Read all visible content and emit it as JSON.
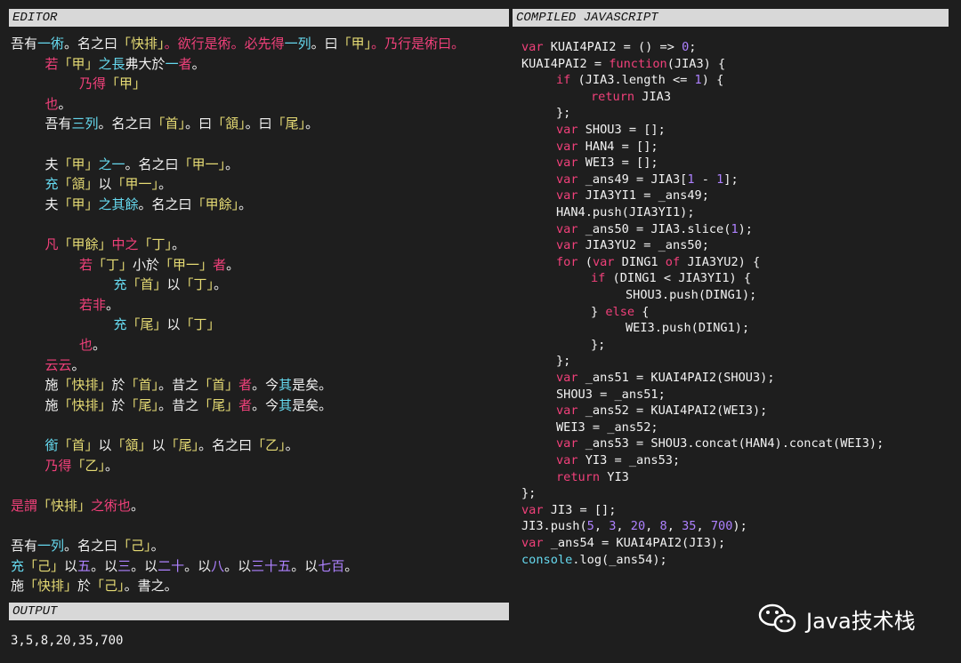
{
  "colors": {
    "white": "#f2f2f2",
    "pink": "#f0407a",
    "green": "#a6e22e",
    "yellow": "#e6db74",
    "cyan": "#66d9ef",
    "purple": "#ae81ff",
    "header_bg": "#d8d8d8"
  },
  "editor": {
    "title": "EDITOR",
    "lines": [
      {
        "indent": 0,
        "segs": [
          [
            "吾有",
            "w"
          ],
          [
            "一術",
            "c"
          ],
          [
            "。名之曰",
            "w"
          ],
          [
            "「快排」",
            "y"
          ],
          [
            "。欲行是術。必先得",
            "p"
          ],
          [
            "一列",
            "c"
          ],
          [
            "。曰",
            "w"
          ],
          [
            "「甲」",
            "y"
          ],
          [
            "。乃行是術曰。",
            "p"
          ]
        ]
      },
      {
        "indent": 1,
        "segs": [
          [
            "若",
            "p"
          ],
          [
            "「甲」",
            "y"
          ],
          [
            "之長",
            "c"
          ],
          [
            "弗大於",
            "w"
          ],
          [
            "一",
            "c"
          ],
          [
            "者",
            "p"
          ],
          [
            "。",
            "w"
          ]
        ]
      },
      {
        "indent": 2,
        "segs": [
          [
            "乃得",
            "p"
          ],
          [
            "「甲」",
            "y"
          ]
        ]
      },
      {
        "indent": 1,
        "segs": [
          [
            "也",
            "p"
          ],
          [
            "。",
            "w"
          ]
        ]
      },
      {
        "indent": 1,
        "segs": [
          [
            "吾有",
            "w"
          ],
          [
            "三列",
            "c"
          ],
          [
            "。名之曰",
            "w"
          ],
          [
            "「首」",
            "y"
          ],
          [
            "。曰",
            "w"
          ],
          [
            "「頷」",
            "y"
          ],
          [
            "。曰",
            "w"
          ],
          [
            "「尾」",
            "y"
          ],
          [
            "。",
            "w"
          ]
        ]
      },
      null,
      {
        "indent": 1,
        "segs": [
          [
            "夫",
            "w"
          ],
          [
            "「甲」",
            "y"
          ],
          [
            "之一",
            "c"
          ],
          [
            "。名之曰",
            "w"
          ],
          [
            "「甲一」",
            "y"
          ],
          [
            "。",
            "w"
          ]
        ]
      },
      {
        "indent": 1,
        "segs": [
          [
            "充",
            "c"
          ],
          [
            "「頷」",
            "y"
          ],
          [
            "以",
            "w"
          ],
          [
            "「甲一」",
            "y"
          ],
          [
            "。",
            "w"
          ]
        ]
      },
      {
        "indent": 1,
        "segs": [
          [
            "夫",
            "w"
          ],
          [
            "「甲」",
            "y"
          ],
          [
            "之其餘",
            "c"
          ],
          [
            "。名之曰",
            "w"
          ],
          [
            "「甲餘」",
            "y"
          ],
          [
            "。",
            "w"
          ]
        ]
      },
      null,
      {
        "indent": 1,
        "segs": [
          [
            "凡",
            "p"
          ],
          [
            "「甲餘」",
            "y"
          ],
          [
            "中之",
            "p"
          ],
          [
            "「丁」",
            "y"
          ],
          [
            "。",
            "w"
          ]
        ]
      },
      {
        "indent": 2,
        "segs": [
          [
            "若",
            "p"
          ],
          [
            "「丁」",
            "y"
          ],
          [
            "小於",
            "w"
          ],
          [
            "「甲一」",
            "y"
          ],
          [
            "者",
            "p"
          ],
          [
            "。",
            "w"
          ]
        ]
      },
      {
        "indent": 3,
        "segs": [
          [
            "充",
            "c"
          ],
          [
            "「首」",
            "y"
          ],
          [
            "以",
            "w"
          ],
          [
            "「丁」",
            "y"
          ],
          [
            "。",
            "w"
          ]
        ]
      },
      {
        "indent": 2,
        "segs": [
          [
            "若非",
            "p"
          ],
          [
            "。",
            "w"
          ]
        ]
      },
      {
        "indent": 3,
        "segs": [
          [
            "充",
            "c"
          ],
          [
            "「尾」",
            "y"
          ],
          [
            "以",
            "w"
          ],
          [
            "「丁」",
            "y"
          ]
        ]
      },
      {
        "indent": 2,
        "segs": [
          [
            "也",
            "p"
          ],
          [
            "。",
            "w"
          ]
        ]
      },
      {
        "indent": 1,
        "segs": [
          [
            "云云",
            "p"
          ],
          [
            "。",
            "w"
          ]
        ]
      },
      {
        "indent": 1,
        "segs": [
          [
            "施",
            "w"
          ],
          [
            "「快排」",
            "y"
          ],
          [
            "於",
            "w"
          ],
          [
            "「首」",
            "y"
          ],
          [
            "。昔之",
            "w"
          ],
          [
            "「首」",
            "y"
          ],
          [
            "者",
            "p"
          ],
          [
            "。今",
            "w"
          ],
          [
            "其",
            "c"
          ],
          [
            "是矣",
            "w"
          ],
          [
            "。",
            "w"
          ]
        ]
      },
      {
        "indent": 1,
        "segs": [
          [
            "施",
            "w"
          ],
          [
            "「快排」",
            "y"
          ],
          [
            "於",
            "w"
          ],
          [
            "「尾」",
            "y"
          ],
          [
            "。昔之",
            "w"
          ],
          [
            "「尾」",
            "y"
          ],
          [
            "者",
            "p"
          ],
          [
            "。今",
            "w"
          ],
          [
            "其",
            "c"
          ],
          [
            "是矣",
            "w"
          ],
          [
            "。",
            "w"
          ]
        ]
      },
      null,
      {
        "indent": 1,
        "segs": [
          [
            "銜",
            "c"
          ],
          [
            "「首」",
            "y"
          ],
          [
            "以",
            "w"
          ],
          [
            "「頷」",
            "y"
          ],
          [
            "以",
            "w"
          ],
          [
            "「尾」",
            "y"
          ],
          [
            "。名之曰",
            "w"
          ],
          [
            "「乙」",
            "y"
          ],
          [
            "。",
            "w"
          ]
        ]
      },
      {
        "indent": 1,
        "segs": [
          [
            "乃得",
            "p"
          ],
          [
            "「乙」",
            "y"
          ],
          [
            "。",
            "w"
          ]
        ]
      },
      null,
      {
        "indent": 0,
        "segs": [
          [
            "是謂",
            "p"
          ],
          [
            "「快排」",
            "y"
          ],
          [
            "之術也",
            "p"
          ],
          [
            "。",
            "w"
          ]
        ]
      },
      null,
      {
        "indent": 0,
        "segs": [
          [
            "吾有",
            "w"
          ],
          [
            "一列",
            "c"
          ],
          [
            "。名之曰",
            "w"
          ],
          [
            "「己」",
            "y"
          ],
          [
            "。",
            "w"
          ]
        ]
      },
      {
        "indent": 0,
        "segs": [
          [
            "充",
            "c"
          ],
          [
            "「己」",
            "y"
          ],
          [
            "以",
            "w"
          ],
          [
            "五",
            "u"
          ],
          [
            "。以",
            "w"
          ],
          [
            "三",
            "u"
          ],
          [
            "。以",
            "w"
          ],
          [
            "二十",
            "u"
          ],
          [
            "。以",
            "w"
          ],
          [
            "八",
            "u"
          ],
          [
            "。以",
            "w"
          ],
          [
            "三十五",
            "u"
          ],
          [
            "。以",
            "w"
          ],
          [
            "七百",
            "u"
          ],
          [
            "。",
            "w"
          ]
        ]
      },
      {
        "indent": 0,
        "segs": [
          [
            "施",
            "w"
          ],
          [
            "「快排」",
            "y"
          ],
          [
            "於",
            "w"
          ],
          [
            "「己」",
            "y"
          ],
          [
            "。書之",
            "w"
          ],
          [
            "。",
            "w"
          ]
        ]
      }
    ]
  },
  "compiled": {
    "title": "COMPILED JAVASCRIPT",
    "lines": [
      {
        "indent": 0,
        "segs": [
          [
            "var",
            "p"
          ],
          [
            " KUAI4PAI2 = () => ",
            "w"
          ],
          [
            "0",
            "u"
          ],
          [
            ";",
            "w"
          ]
        ]
      },
      {
        "indent": 0,
        "segs": [
          [
            "KUAI4PAI2 = ",
            "w"
          ],
          [
            "function",
            "p"
          ],
          [
            "(JIA3) {",
            "w"
          ]
        ]
      },
      {
        "indent": 1,
        "segs": [
          [
            "if",
            "p"
          ],
          [
            " (JIA3.length <= ",
            "w"
          ],
          [
            "1",
            "u"
          ],
          [
            ") {",
            "w"
          ]
        ]
      },
      {
        "indent": 2,
        "segs": [
          [
            "return",
            "p"
          ],
          [
            " JIA3",
            "w"
          ]
        ]
      },
      {
        "indent": 1,
        "segs": [
          [
            "};",
            "w"
          ]
        ]
      },
      {
        "indent": 1,
        "segs": [
          [
            "var",
            "p"
          ],
          [
            " SHOU3 = [];",
            "w"
          ]
        ]
      },
      {
        "indent": 1,
        "segs": [
          [
            "var",
            "p"
          ],
          [
            " HAN4 = [];",
            "w"
          ]
        ]
      },
      {
        "indent": 1,
        "segs": [
          [
            "var",
            "p"
          ],
          [
            " WEI3 = [];",
            "w"
          ]
        ]
      },
      {
        "indent": 1,
        "segs": [
          [
            "var",
            "p"
          ],
          [
            " _ans49 = JIA3[",
            "w"
          ],
          [
            "1",
            "u"
          ],
          [
            " - ",
            "w"
          ],
          [
            "1",
            "u"
          ],
          [
            "];",
            "w"
          ]
        ]
      },
      {
        "indent": 1,
        "segs": [
          [
            "var",
            "p"
          ],
          [
            " JIA3YI1 = _ans49;",
            "w"
          ]
        ]
      },
      {
        "indent": 1,
        "segs": [
          [
            "HAN4.push(JIA3YI1);",
            "w"
          ]
        ]
      },
      {
        "indent": 1,
        "segs": [
          [
            "var",
            "p"
          ],
          [
            " _ans50 = JIA3.slice(",
            "w"
          ],
          [
            "1",
            "u"
          ],
          [
            ");",
            "w"
          ]
        ]
      },
      {
        "indent": 1,
        "segs": [
          [
            "var",
            "p"
          ],
          [
            " JIA3YU2 = _ans50;",
            "w"
          ]
        ]
      },
      {
        "indent": 1,
        "segs": [
          [
            "for",
            "p"
          ],
          [
            " (",
            "w"
          ],
          [
            "var",
            "p"
          ],
          [
            " DING1 ",
            "w"
          ],
          [
            "of",
            "p"
          ],
          [
            " JIA3YU2) {",
            "w"
          ]
        ]
      },
      {
        "indent": 2,
        "segs": [
          [
            "if",
            "p"
          ],
          [
            " (DING1 < JIA3YI1) {",
            "w"
          ]
        ]
      },
      {
        "indent": 3,
        "segs": [
          [
            "SHOU3.push(DING1);",
            "w"
          ]
        ]
      },
      {
        "indent": 2,
        "segs": [
          [
            "} ",
            "w"
          ],
          [
            "else",
            "p"
          ],
          [
            " {",
            "w"
          ]
        ]
      },
      {
        "indent": 3,
        "segs": [
          [
            "WEI3.push(DING1);",
            "w"
          ]
        ]
      },
      {
        "indent": 2,
        "segs": [
          [
            "};",
            "w"
          ]
        ]
      },
      {
        "indent": 1,
        "segs": [
          [
            "};",
            "w"
          ]
        ]
      },
      {
        "indent": 1,
        "segs": [
          [
            "var",
            "p"
          ],
          [
            " _ans51 = KUAI4PAI2(SHOU3);",
            "w"
          ]
        ]
      },
      {
        "indent": 1,
        "segs": [
          [
            "SHOU3 = _ans51;",
            "w"
          ]
        ]
      },
      {
        "indent": 1,
        "segs": [
          [
            "var",
            "p"
          ],
          [
            " _ans52 = KUAI4PAI2(WEI3);",
            "w"
          ]
        ]
      },
      {
        "indent": 1,
        "segs": [
          [
            "WEI3 = _ans52;",
            "w"
          ]
        ]
      },
      {
        "indent": 1,
        "segs": [
          [
            "var",
            "p"
          ],
          [
            " _ans53 = SHOU3.concat(HAN4).concat(WEI3);",
            "w"
          ]
        ]
      },
      {
        "indent": 1,
        "segs": [
          [
            "var",
            "p"
          ],
          [
            " YI3 = _ans53;",
            "w"
          ]
        ]
      },
      {
        "indent": 1,
        "segs": [
          [
            "return",
            "p"
          ],
          [
            " YI3",
            "w"
          ]
        ]
      },
      {
        "indent": 0,
        "segs": [
          [
            "};",
            "w"
          ]
        ]
      },
      {
        "indent": 0,
        "segs": [
          [
            "var",
            "p"
          ],
          [
            " JI3 = [];",
            "w"
          ]
        ]
      },
      {
        "indent": 0,
        "segs": [
          [
            "JI3.push(",
            "w"
          ],
          [
            "5",
            "u"
          ],
          [
            ", ",
            "w"
          ],
          [
            "3",
            "u"
          ],
          [
            ", ",
            "w"
          ],
          [
            "20",
            "u"
          ],
          [
            ", ",
            "w"
          ],
          [
            "8",
            "u"
          ],
          [
            ", ",
            "w"
          ],
          [
            "35",
            "u"
          ],
          [
            ", ",
            "w"
          ],
          [
            "700",
            "u"
          ],
          [
            ");",
            "w"
          ]
        ]
      },
      {
        "indent": 0,
        "segs": [
          [
            "var",
            "p"
          ],
          [
            " _ans54 = KUAI4PAI2(JI3);",
            "w"
          ]
        ]
      },
      {
        "indent": 0,
        "segs": [
          [
            "console",
            "c"
          ],
          [
            ".log(_ans54);",
            "w"
          ]
        ]
      }
    ]
  },
  "output": {
    "title": "OUTPUT",
    "text": "3,5,8,20,35,700"
  },
  "watermark": {
    "text": "Java技术栈",
    "icon": "wechat-icon"
  }
}
